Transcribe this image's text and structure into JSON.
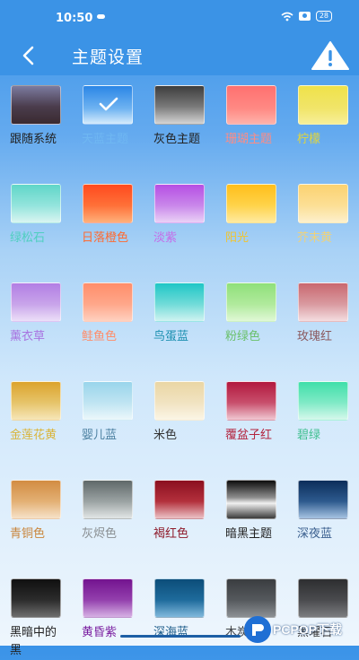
{
  "status": {
    "time": "10:50",
    "battery": "28"
  },
  "header": {
    "title": "主题设置"
  },
  "themes": [
    {
      "label": "跟随系统",
      "swatch": "linear-gradient(180deg,#7c7ba0 0%,#4a3c4c 55%,#3a2a30 100%)",
      "color": "#222222",
      "selected": false
    },
    {
      "label": "天蓝主题",
      "swatch": "linear-gradient(180deg,#2b86e6 0%,#6fb3f1 60%,#d6ecfc 100%)",
      "color": "#6fb7f2",
      "selected": true
    },
    {
      "label": "灰色主题",
      "swatch": "linear-gradient(180deg,#3d3d3d 0%,#7a7a7a 55%,#d4d4d4 100%)",
      "color": "#222222",
      "selected": false
    },
    {
      "label": "珊瑚主题",
      "swatch": "linear-gradient(180deg,#ff7070 0%,#ff8a84 60%,#ffb2aa 100%)",
      "color": "#ff8c84",
      "selected": false
    },
    {
      "label": "柠檬",
      "swatch": "linear-gradient(180deg,#efe24a 0%,#f1e56a 60%,#f7ef98 100%)",
      "color": "#e3d63a",
      "selected": false
    },
    {
      "label": "绿松石",
      "swatch": "linear-gradient(180deg,#60d6c8 0%,#93e4dc 55%,#d9f5f1 100%)",
      "color": "#4fcfbf",
      "selected": false
    },
    {
      "label": "日落橙色",
      "swatch": "linear-gradient(180deg,#ff4a1e 0%,#ff7038 55%,#ffb07a 100%)",
      "color": "#ff6a30",
      "selected": false
    },
    {
      "label": "淡紫",
      "swatch": "linear-gradient(180deg,#b64fe4 0%,#c987ea 55%,#ead1f6 100%)",
      "color": "#c66ae8",
      "selected": false
    },
    {
      "label": "阳光",
      "swatch": "linear-gradient(180deg,#ffbe1a 0%,#ffd34a 55%,#ffeaa0 100%)",
      "color": "#f0c530",
      "selected": false
    },
    {
      "label": "芥末黄",
      "swatch": "linear-gradient(180deg,#fbd271 0%,#fcdf95 55%,#fdf0cc 100%)",
      "color": "#efd27a",
      "selected": false
    },
    {
      "label": "薰衣草",
      "swatch": "linear-gradient(180deg,#b27ee4 0%,#c8a4ea 55%,#ecdff8 100%)",
      "color": "#a873e0",
      "selected": false
    },
    {
      "label": "鲑鱼色",
      "swatch": "linear-gradient(180deg,#ff8d6a 0%,#ffa78a 55%,#ffd1c0 100%)",
      "color": "#ff8d6a",
      "selected": false
    },
    {
      "label": "鸟蛋蓝",
      "swatch": "linear-gradient(180deg,#1fc6c6 0%,#70dbd8 55%,#d0f3f1 100%)",
      "color": "#1a8fb0",
      "selected": false
    },
    {
      "label": "粉绿色",
      "swatch": "linear-gradient(180deg,#8fe07a 0%,#b0ea9c 55%,#e0f8d6 100%)",
      "color": "#6ac06a",
      "selected": false
    },
    {
      "label": "玫瑰红",
      "swatch": "linear-gradient(180deg,#c9686f 0%,#d99aa0 55%,#f4dde0 100%)",
      "color": "#8b5a5f",
      "selected": false
    },
    {
      "label": "金莲花黄",
      "swatch": "linear-gradient(180deg,#dca32c 0%,#e6c46a 55%,#f6e6b8 100%)",
      "color": "#d9b43a",
      "selected": false
    },
    {
      "label": "婴儿蓝",
      "swatch": "linear-gradient(180deg,#99d5eb 0%,#bfe4f2 55%,#ecf7fb 100%)",
      "color": "#4a7fa0",
      "selected": false
    },
    {
      "label": "米色",
      "swatch": "linear-gradient(180deg,#ead6a4 0%,#f1e3c1 55%,#fbf5e6 100%)",
      "color": "#333333",
      "selected": false
    },
    {
      "label": "覆盆子红",
      "swatch": "linear-gradient(180deg,#b2183e 0%,#c84f6c 55%,#f0c8d2 100%)",
      "color": "#b3243e",
      "selected": false
    },
    {
      "label": "碧绿",
      "swatch": "linear-gradient(180deg,#3fdfa9 0%,#80eac6 55%,#d6f8ec 100%)",
      "color": "#3fbf8f",
      "selected": false
    },
    {
      "label": "青铜色",
      "swatch": "linear-gradient(180deg,#d28c42 0%,#e3b074 55%,#f6e2c8 100%)",
      "color": "#c9853b",
      "selected": false
    },
    {
      "label": "灰烬色",
      "swatch": "linear-gradient(180deg,#5f6869 0%,#9ba3a3 55%,#e2e6e6 100%)",
      "color": "#8a8f92",
      "selected": false
    },
    {
      "label": "褐红色",
      "swatch": "linear-gradient(180deg,#8b0f1f 0%,#b3303c 55%,#ecc2c6 100%)",
      "color": "#8e1a2a",
      "selected": false
    },
    {
      "label": "暗黑主题",
      "swatch": "linear-gradient(180deg,#0d0d0d 0%,#8e8e8e 45%,#f0f0f0 60%,#3b3b3b 100%)",
      "color": "#222222",
      "selected": false
    },
    {
      "label": "深夜蓝",
      "swatch": "linear-gradient(180deg,#0c2d5a 0%,#2d5a8e 55%,#a6c3e2 100%)",
      "color": "#3a5f8e",
      "selected": false
    },
    {
      "label": "黑暗中的黑",
      "swatch": "linear-gradient(180deg,#101010 0%,#2c2c2c 55%,#6e6e6e 100%)",
      "color": "#222222",
      "selected": false
    },
    {
      "label": "黄昏紫",
      "swatch": "linear-gradient(180deg,#73138f 0%,#9340ad 55%,#d6b0e4 100%)",
      "color": "#7a1ea0",
      "selected": false
    },
    {
      "label": "深海蓝",
      "swatch": "linear-gradient(180deg,#0c4d79 0%,#1e6b9c 55%,#80b8dc 100%)",
      "color": "#1a5a88",
      "selected": false
    },
    {
      "label": "木炭灰",
      "swatch": "linear-gradient(180deg,#3a3d40 0%,#55595d 55%,#8c9094 100%)",
      "color": "#404448",
      "selected": false
    },
    {
      "label": "黑曜石",
      "swatch": "linear-gradient(180deg,#2d2e30 0%,#4a4b4e 55%,#7c7d80 100%)",
      "color": "#333333",
      "selected": false
    }
  ],
  "watermark": {
    "text": "PCPOP下载"
  }
}
